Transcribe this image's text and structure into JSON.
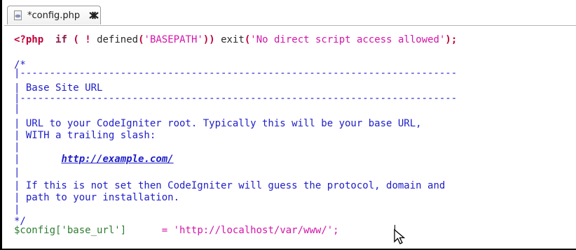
{
  "tab": {
    "title": "*config.php",
    "file_icon": "php-file-icon",
    "close_icon": "close-icon"
  },
  "code": {
    "line1": {
      "open_tag": "<?php",
      "kw_if": "if",
      "paren_open": "(",
      "bang": "!",
      "fn_defined": "defined",
      "paren_open2": "(",
      "str_basepath": "'BASEPATH'",
      "paren_close2": "))",
      "fn_exit": "exit",
      "paren_open3": "(",
      "str_msg": "'No direct script access allowed'",
      "paren_close3": ");"
    },
    "comment_open": "/*",
    "dash_line": "|--------------------------------------------------------------------------",
    "base_site_url": "| Base Site URL",
    "pipe": "|",
    "desc1": "| URL to your CodeIgniter root. Typically this will be your base URL,",
    "desc2": "| WITH a trailing slash:",
    "example_prefix": "|",
    "example_url": "http://example.com/",
    "desc3": "| If this is not set then CodeIgniter will guess the protocol, domain and",
    "desc4": "| path to your installation.",
    "comment_close": "*/",
    "assign": {
      "var": "$config['base_url']",
      "op": "=",
      "value": "'http://localhost/var/www/';"
    }
  }
}
